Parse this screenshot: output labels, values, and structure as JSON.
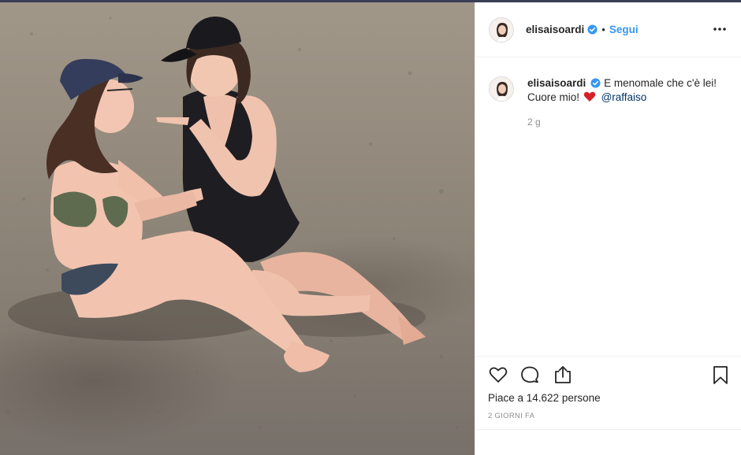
{
  "post": {
    "username": "elisaisoardi",
    "follow_label": "Segui",
    "dot": "•",
    "caption_line1": "E menomale che c'è lei!",
    "caption_line2": "Cuore mio!",
    "mention": "@raffaiso",
    "time_ago": "2 g",
    "likes_text": "Piace a 14.622 persone",
    "date_text": "2 GIORNI FA"
  },
  "icons": {
    "verified": "verified-badge-icon",
    "more": "more-options-icon",
    "heart_emoji": "red-heart-emoji",
    "like": "heart-outline-icon",
    "comment": "comment-icon",
    "share": "share-icon",
    "save": "bookmark-icon"
  },
  "colors": {
    "accent_blue": "#3897f0",
    "mention": "#003569",
    "heart_red": "#d6212b",
    "muted_text": "#8e8e8e"
  }
}
